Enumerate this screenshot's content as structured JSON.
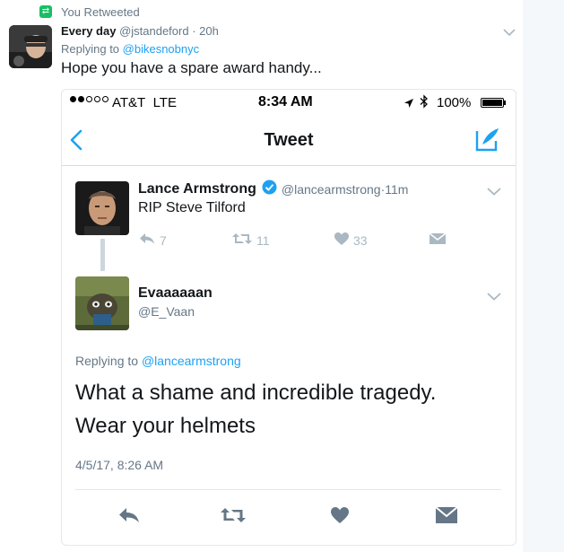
{
  "retweet_context": {
    "text": "You Retweeted"
  },
  "outer_tweet": {
    "author_name": "Every day",
    "author_handle": "@jstandeford",
    "time_sep": " · ",
    "time": "20h",
    "replying_label": "Replying to ",
    "replying_handle": "@bikesnobnyc",
    "text": "Hope you have a spare award handy..."
  },
  "phone": {
    "carrier": "AT&T",
    "network": "LTE",
    "clock": "8:34 AM",
    "battery": "100%",
    "battery_level": 1.0,
    "signal_bars_filled": 2,
    "signal_bars_total": 5,
    "nav_title": "Tweet"
  },
  "original_tweet": {
    "author_name": "Lance Armstrong",
    "author_handle": "@lancearmstrong",
    "time_sep": " · ",
    "time": "11m",
    "text": "RIP Steve Tilford",
    "reply_count": "7",
    "retweet_count": "11",
    "like_count": "33"
  },
  "reply_tweet": {
    "author_name": "Evaaaaaan",
    "author_handle": "@E_Vaan",
    "replying_label": "Replying to ",
    "replying_handle": "@lancearmstrong",
    "text_line1": "What a shame and incredible tragedy.",
    "text_line2": "Wear your helmets",
    "timestamp": "4/5/17, 8:26 AM"
  },
  "colors": {
    "accent": "#1da1f2",
    "retweet_green": "#17bf63",
    "muted": "#657786",
    "icon_gray": "#aab8c2"
  },
  "icons": [
    "retweet-icon",
    "chevron-down-icon",
    "back-arrow-icon",
    "compose-icon",
    "verified-badge-icon",
    "reply-icon",
    "like-icon",
    "direct-message-icon",
    "location-arrow-icon",
    "bluetooth-icon",
    "battery-icon"
  ]
}
